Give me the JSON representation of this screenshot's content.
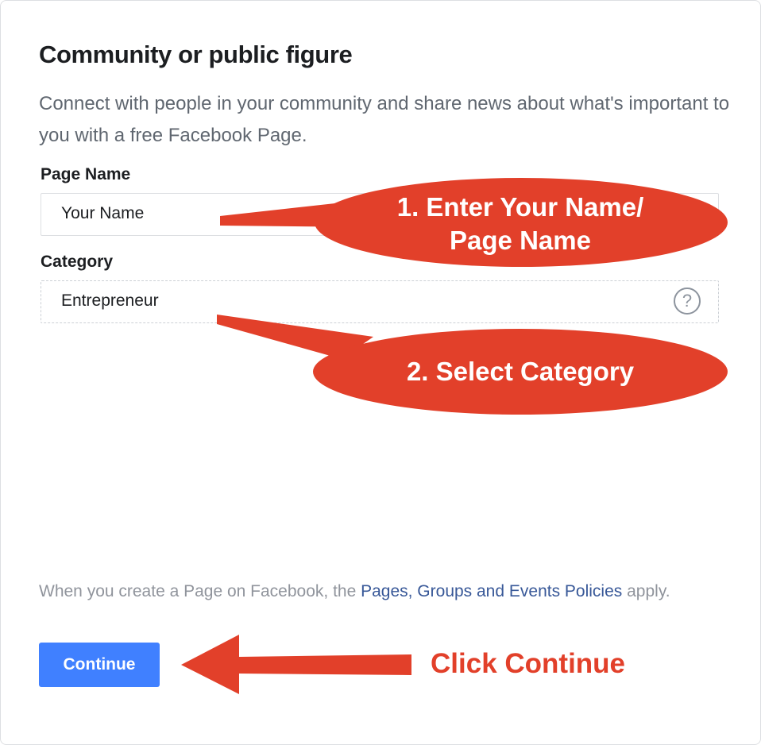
{
  "dialog": {
    "title": "Community or public figure",
    "description": "Connect with people in your community and share news about what's important to you with a free Facebook Page."
  },
  "form": {
    "page_name_label": "Page Name",
    "page_name_value": "Your Name",
    "category_label": "Category",
    "category_value": "Entrepreneur",
    "category_help_icon": "question-circle-icon"
  },
  "policy": {
    "prefix": "When you create a Page on Facebook, the ",
    "link": "Pages, Groups and Events Policies",
    "suffix": " apply."
  },
  "buttons": {
    "continue": "Continue"
  },
  "annotations": {
    "callout_1_line1": "1. Enter Your Name/",
    "callout_1_line2": "Page Name",
    "callout_2": "2. Select Category",
    "click_continue": "Click Continue"
  },
  "colors": {
    "annotation_red": "#e2402a",
    "button_blue": "#4080ff",
    "link_blue": "#385898"
  }
}
